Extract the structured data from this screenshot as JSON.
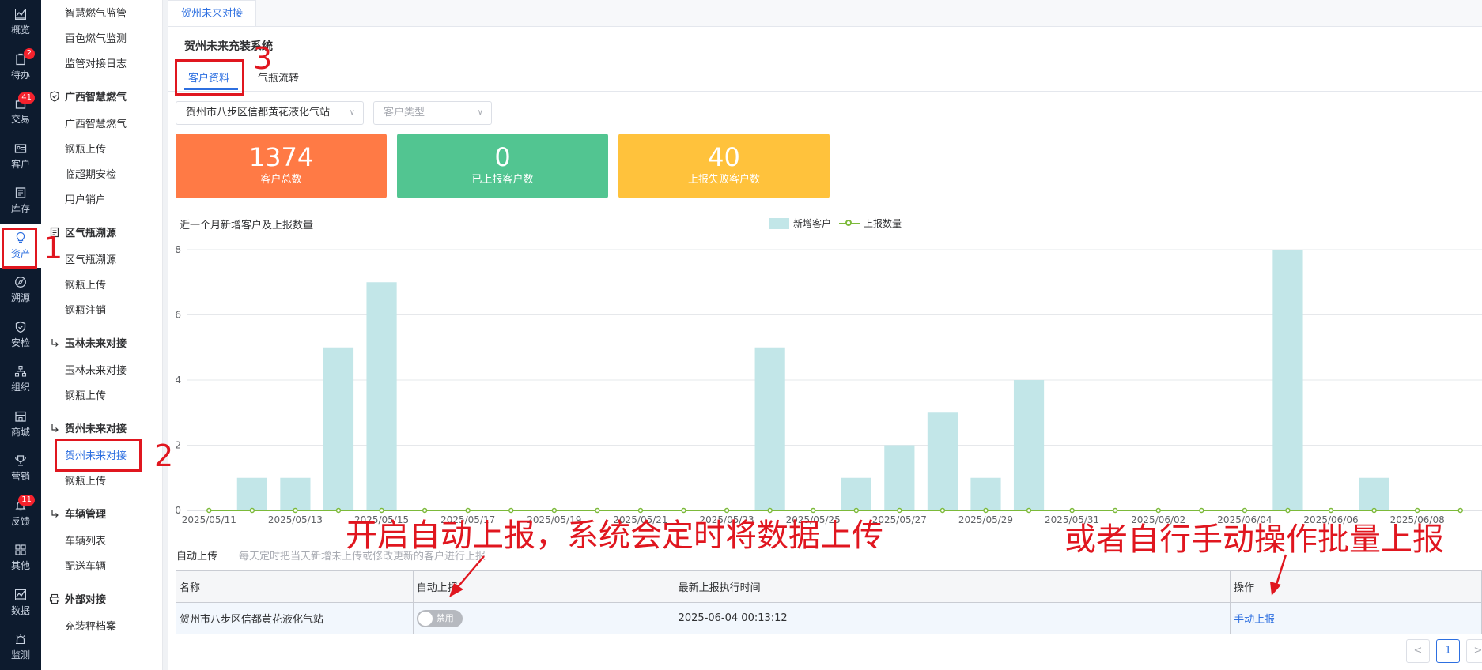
{
  "rail": {
    "items": [
      {
        "label": "概览",
        "icon": "chart-icon"
      },
      {
        "label": "待办",
        "icon": "clipboard-icon",
        "badge": "2"
      },
      {
        "label": "交易",
        "icon": "bag-icon",
        "badge": "41"
      },
      {
        "label": "客户",
        "icon": "id-card-icon"
      },
      {
        "label": "库存",
        "icon": "list-icon"
      },
      {
        "label": "资产",
        "icon": "bulb-icon",
        "active": true
      },
      {
        "label": "溯源",
        "icon": "compass-icon"
      },
      {
        "label": "安检",
        "icon": "shield-icon"
      },
      {
        "label": "组织",
        "icon": "org-icon"
      },
      {
        "label": "商城",
        "icon": "shop-icon"
      },
      {
        "label": "营销",
        "icon": "trophy-icon"
      },
      {
        "label": "反馈",
        "icon": "bell-icon",
        "badge": "11"
      },
      {
        "label": "其他",
        "icon": "grid-icon"
      },
      {
        "label": "数据",
        "icon": "chart-icon"
      },
      {
        "label": "监测",
        "icon": "alarm-icon"
      }
    ]
  },
  "submenu": {
    "items_top": [
      "智慧燃气监管",
      "百色燃气监测",
      "监管对接日志"
    ],
    "groups": [
      {
        "title": "广西智慧燃气",
        "icon": "shield-icon",
        "items": [
          "广西智慧燃气",
          "钢瓶上传",
          "临超期安检",
          "用户销户"
        ]
      },
      {
        "title": "区气瓶溯源",
        "icon": "document-icon",
        "items": [
          "区气瓶溯源",
          "钢瓶上传",
          "钢瓶注销"
        ]
      },
      {
        "title": "玉林未来对接",
        "icon": "return-icon",
        "items": [
          "玉林未来对接",
          "钢瓶上传"
        ]
      },
      {
        "title": "贺州未来对接",
        "icon": "return-icon",
        "items": [
          "贺州未来对接",
          "钢瓶上传"
        ]
      },
      {
        "title": "车辆管理",
        "icon": "return-icon",
        "items": [
          "车辆列表",
          "配送车辆"
        ]
      },
      {
        "title": "外部对接",
        "icon": "printer-icon",
        "items": [
          "充装秤档案"
        ]
      }
    ]
  },
  "page_tab": "贺州未来对接",
  "system_title": "贺州未来充装系统",
  "sub_tabs": [
    "客户资料",
    "气瓶流转"
  ],
  "filters": {
    "station": "贺州市八步区信都黄花液化气站",
    "customer_type_placeholder": "客户类型"
  },
  "stats": [
    {
      "value": "1374",
      "label": "客户总数",
      "color": "#ff7a45"
    },
    {
      "value": "0",
      "label": "已上报客户数",
      "color": "#52c591"
    },
    {
      "value": "40",
      "label": "上报失败客户数",
      "color": "#ffc23c"
    }
  ],
  "chart_title": "近一个月新增客户及上报数量",
  "chart_data": {
    "type": "bar",
    "title": "近一个月新增客户及上报数量",
    "categories": [
      "2025/05/11",
      "2025/05/12",
      "2025/05/13",
      "2025/05/14",
      "2025/05/15",
      "2025/05/16",
      "2025/05/17",
      "2025/05/18",
      "2025/05/19",
      "2025/05/20",
      "2025/05/21",
      "2025/05/22",
      "2025/05/23",
      "2025/05/24",
      "2025/05/25",
      "2025/05/26",
      "2025/05/27",
      "2025/05/28",
      "2025/05/29",
      "2025/05/30",
      "2025/05/31",
      "2025/06/01",
      "2025/06/02",
      "2025/06/03",
      "2025/06/04",
      "2025/06/05",
      "2025/06/06",
      "2025/06/07",
      "2025/06/08",
      "2025/06/09"
    ],
    "series": [
      {
        "name": "新增客户",
        "type": "bar",
        "color": "#c2e6e8",
        "values": [
          0,
          1,
          1,
          5,
          7,
          0,
          0,
          0,
          0,
          0,
          0,
          0,
          0,
          5,
          0,
          1,
          2,
          3,
          1,
          4,
          0,
          0,
          0,
          0,
          0,
          8,
          0,
          1,
          0,
          0
        ]
      },
      {
        "name": "上报数量",
        "type": "line",
        "color": "#7cba3a",
        "values": [
          0,
          0,
          0,
          0,
          0,
          0,
          0,
          0,
          0,
          0,
          0,
          0,
          0,
          0,
          0,
          0,
          0,
          0,
          0,
          0,
          0,
          0,
          0,
          0,
          0,
          0,
          0,
          0,
          0,
          0
        ]
      }
    ],
    "ylim": [
      0,
      8
    ],
    "yticks": [
      "0",
      "2",
      "4",
      "6",
      "8"
    ],
    "xtick_labels": [
      "2025/05/11",
      "2025/05/13",
      "2025/05/15",
      "2025/05/17",
      "2025/05/19",
      "2025/05/21",
      "2025/05/23",
      "2025/05/25",
      "2025/05/27",
      "2025/05/29",
      "2025/05/31",
      "2025/06/02",
      "2025/06/04",
      "2025/06/06",
      "2025/06/08"
    ],
    "legend": "top-center",
    "grid": true
  },
  "auto_upload": {
    "label": "自动上传",
    "desc": "每天定时把当天新增未上传或修改更新的客户进行上报"
  },
  "table": {
    "headers": [
      "名称",
      "自动上报",
      "最新上报执行时间",
      "操作"
    ],
    "rows": [
      {
        "name": "贺州市八步区信都黄花液化气站",
        "switch": "禁用",
        "time": "2025-06-04 00:13:12",
        "action": "手动上报"
      }
    ]
  },
  "pager": {
    "prev": "<",
    "page": "1",
    "next": ">"
  },
  "annotations": {
    "n1": "1",
    "n2": "2",
    "n3": "3",
    "text_left": "开启自动上报，系统会定时将数据上传",
    "text_right": "或者自行手动操作批量上报",
    "color": "#e0161f"
  }
}
